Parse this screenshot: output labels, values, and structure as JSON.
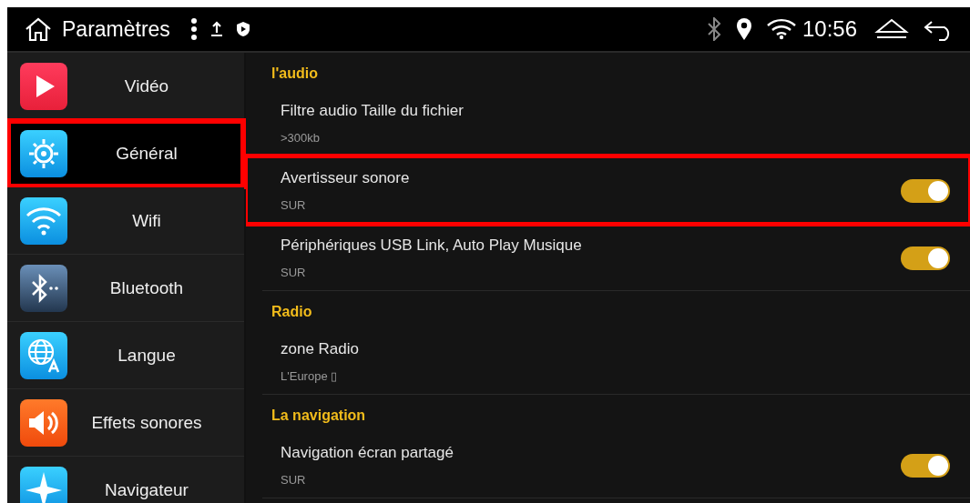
{
  "status_bar": {
    "title": "Paramètres",
    "time": "10:56"
  },
  "sidebar": {
    "items": [
      {
        "label": "Vidéo",
        "kind": "video",
        "selected": false,
        "highlighted": false
      },
      {
        "label": "Général",
        "kind": "general",
        "selected": true,
        "highlighted": true
      },
      {
        "label": "Wifi",
        "kind": "wifi",
        "selected": false,
        "highlighted": false
      },
      {
        "label": "Bluetooth",
        "kind": "bluetooth",
        "selected": false,
        "highlighted": false
      },
      {
        "label": "Langue",
        "kind": "language",
        "selected": false,
        "highlighted": false
      },
      {
        "label": "Effets sonores",
        "kind": "sound",
        "selected": false,
        "highlighted": false
      },
      {
        "label": "Navigateur",
        "kind": "navigator",
        "selected": false,
        "highlighted": false
      }
    ]
  },
  "sections": [
    {
      "title": "l'audio",
      "rows": [
        {
          "kind": "value",
          "label": "Filtre audio Taille du fichier",
          "value": ">300kb",
          "highlighted": false
        },
        {
          "kind": "toggle",
          "label": "Avertisseur sonore",
          "value": "SUR",
          "on": true,
          "highlighted": true
        },
        {
          "kind": "toggle",
          "label": "Périphériques USB Link, Auto Play Musique",
          "value": "SUR",
          "on": true,
          "highlighted": false
        }
      ]
    },
    {
      "title": "Radio",
      "rows": [
        {
          "kind": "value",
          "label": "zone Radio",
          "value": "L'Europe ▯",
          "highlighted": false
        }
      ]
    },
    {
      "title": "La navigation",
      "rows": [
        {
          "kind": "toggle",
          "label": "Navigation écran partagé",
          "value": "SUR",
          "on": true,
          "highlighted": false
        }
      ]
    }
  ]
}
